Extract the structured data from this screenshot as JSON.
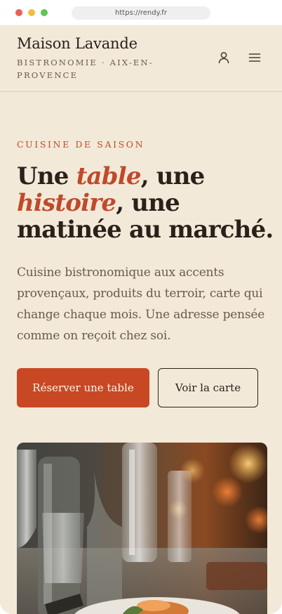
{
  "browser": {
    "url": "https://rendy.fr"
  },
  "header": {
    "brand_name": "Maison Lavande",
    "brand_subtitle": "BISTRONOMIE · AIX-EN-PROVENCE",
    "account_icon": "user-icon",
    "menu_icon": "hamburger-menu-icon"
  },
  "hero": {
    "eyebrow": "CUISINE DE SAISON",
    "headline": {
      "part1": "Une ",
      "em1": "table",
      "part2": ", une ",
      "em2": "histoire",
      "part3": ", une matinée au marché."
    },
    "lead": "Cuisine bistronomique aux accents provençaux, produits du terroir, carte qui change chaque mois. Une adresse pensée comme on reçoit chez soi.",
    "primary_cta": "Réserver une table",
    "secondary_cta": "Voir la carte"
  },
  "colors": {
    "background": "#f2e9d8",
    "accent": "#c84824",
    "text": "#2a211b",
    "muted": "#6b5a4a"
  }
}
